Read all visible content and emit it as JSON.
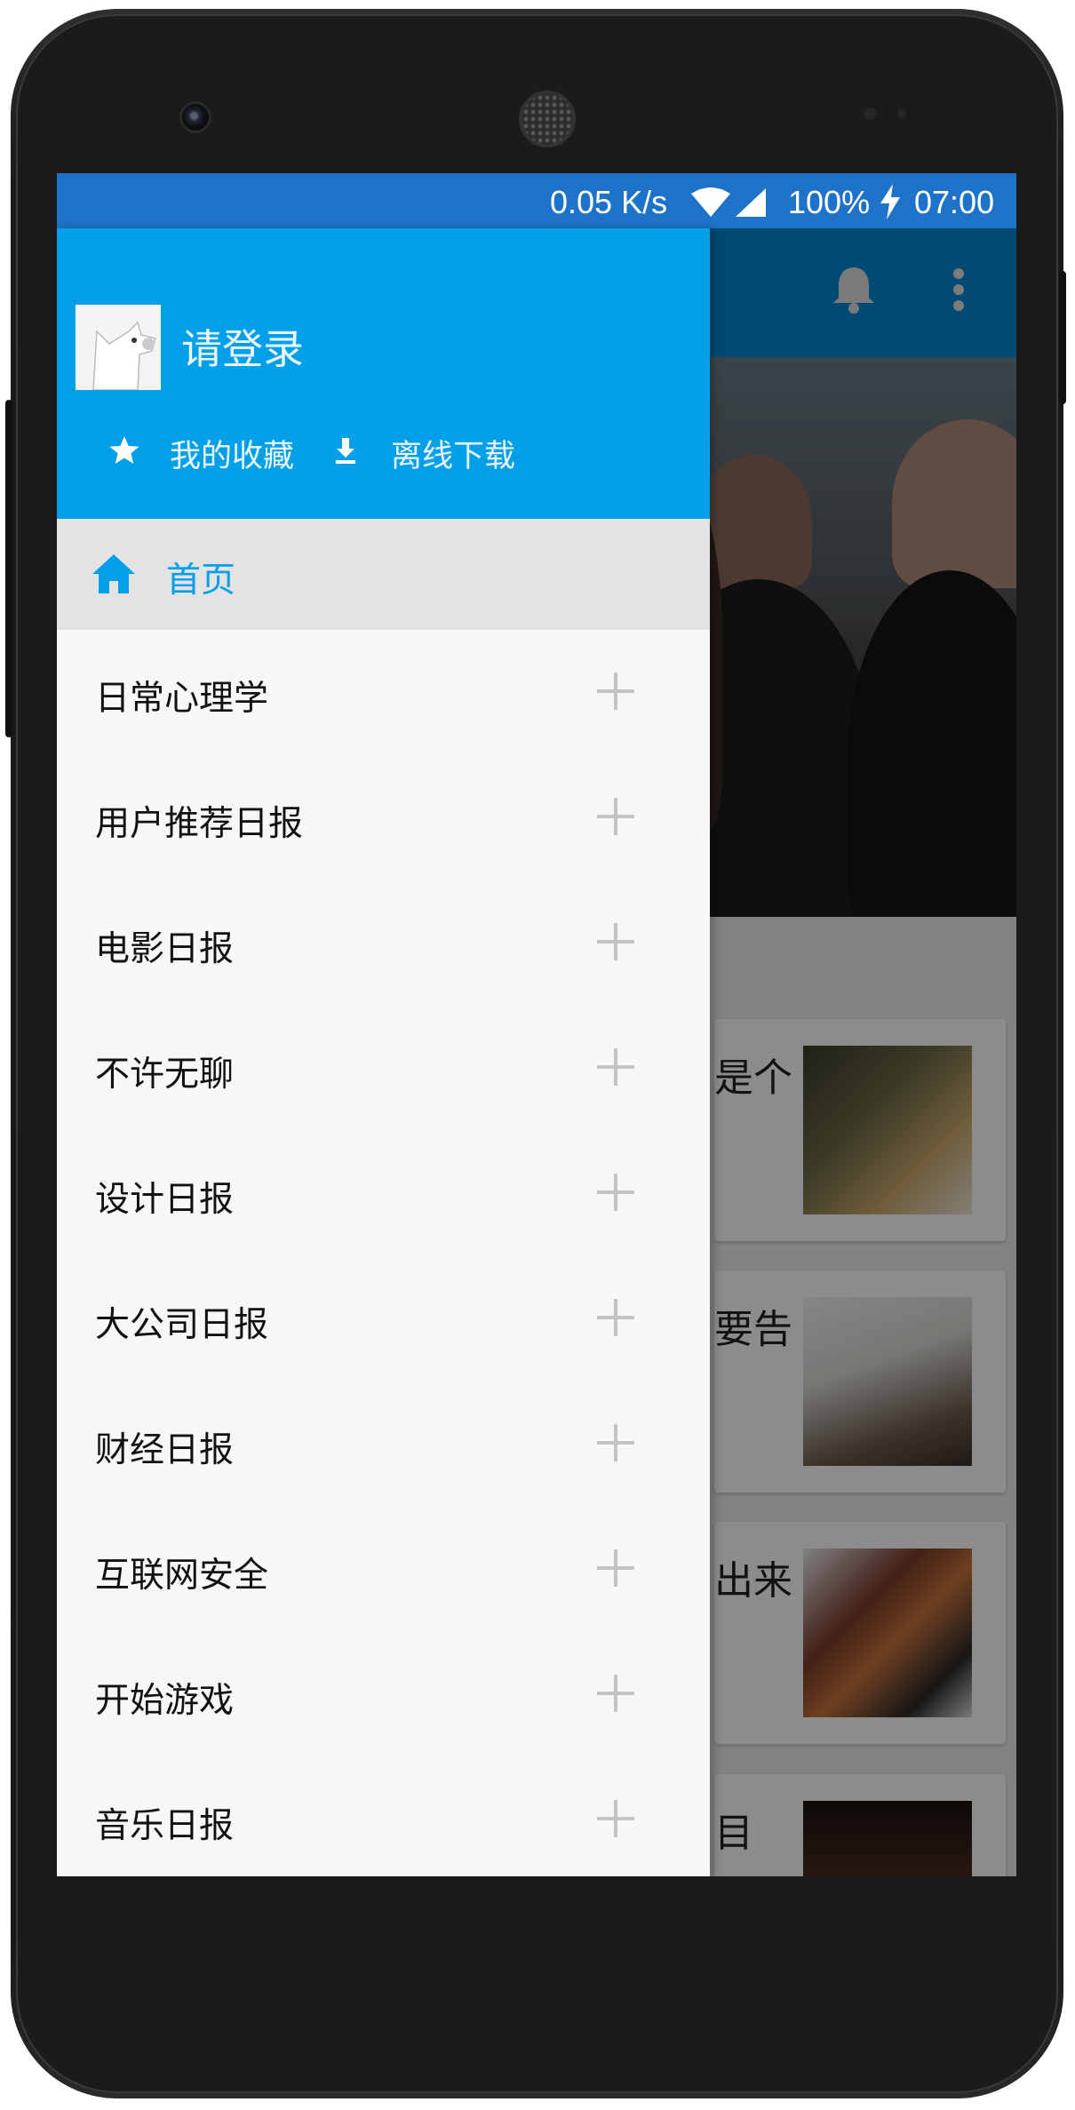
{
  "status_bar": {
    "network_speed": "0.05 K/s",
    "battery": "100%",
    "time": "07:00",
    "icons": [
      "wifi-icon",
      "signal-icon",
      "charging-icon"
    ]
  },
  "toolbar": {
    "icons": [
      "bell-icon",
      "more-vert-icon"
    ]
  },
  "background_cards": [
    {
      "text_fragment": "是个"
    },
    {
      "text_fragment": "要告"
    },
    {
      "text_fragment": "出来"
    },
    {
      "text_fragment": "目"
    }
  ],
  "drawer": {
    "login_label": "请登录",
    "favorites_label": "我的收藏",
    "offline_label": "离线下载",
    "home_label": "首页",
    "items": [
      {
        "label": "日常心理学"
      },
      {
        "label": "用户推荐日报"
      },
      {
        "label": "电影日报"
      },
      {
        "label": "不许无聊"
      },
      {
        "label": "设计日报"
      },
      {
        "label": "大公司日报"
      },
      {
        "label": "财经日报"
      },
      {
        "label": "互联网安全"
      },
      {
        "label": "开始游戏"
      },
      {
        "label": "音乐日报"
      }
    ]
  },
  "colors": {
    "status_bar": "#1e73c9",
    "drawer_header": "#03a0e9",
    "accent": "#03a0e9",
    "toolbar": "#0288d1",
    "home_row_bg": "#e3e3e3",
    "drawer_bg": "#f7f7f7"
  }
}
